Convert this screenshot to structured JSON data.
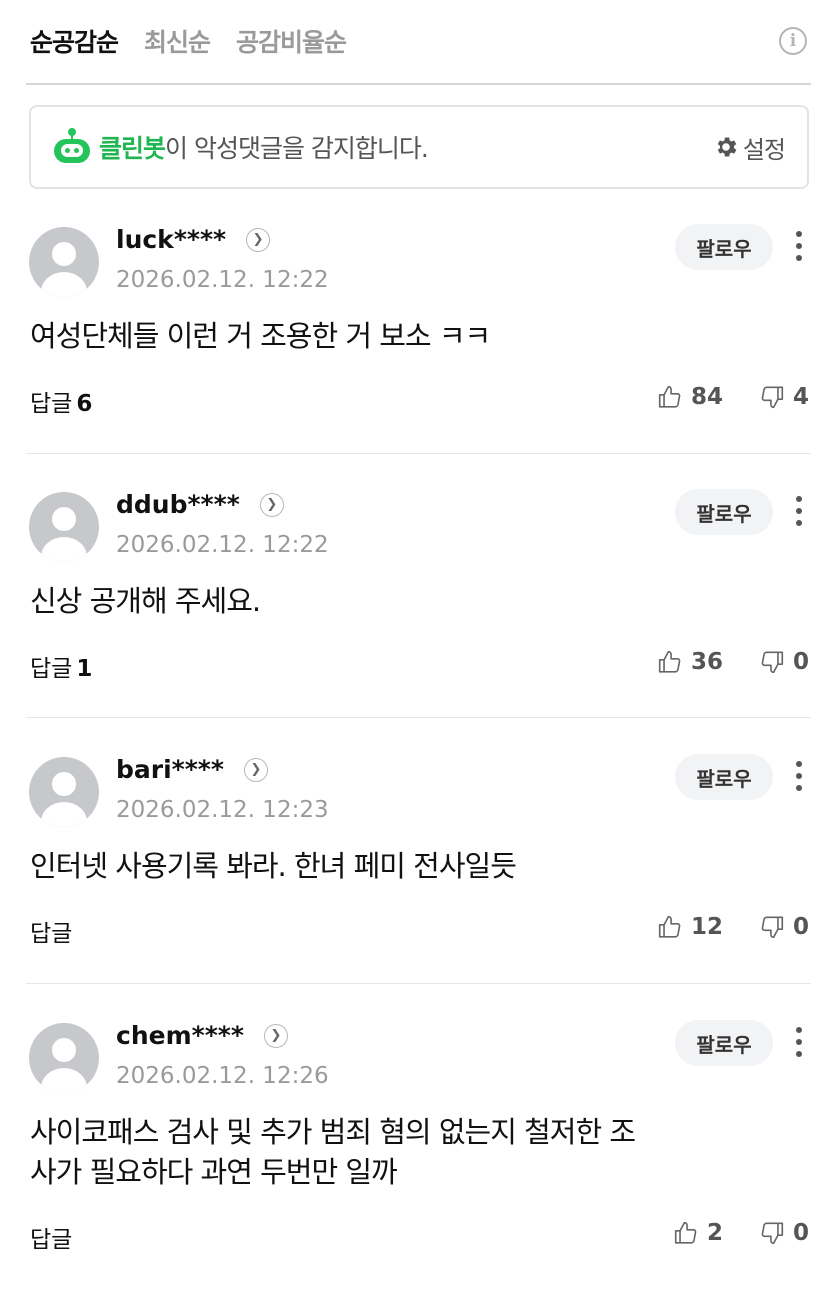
{
  "sort_tabs": [
    "순공감순",
    "최신순",
    "공감비율순"
  ],
  "info_icon_glyph": "i",
  "cleanbot": {
    "brand": "클린봇",
    "message": "이 악성댓글을 감지합니다.",
    "settings_label": "설정"
  },
  "follow_label": "팔로우",
  "reply_label": "답글",
  "comments": [
    {
      "user": "luck****",
      "date": "2026.02.12. 12:22",
      "text": "여성단체들 이런 거 조용한 거 보소 ㅋㅋ",
      "replies": "6",
      "likes": "84",
      "dislikes": "4"
    },
    {
      "user": "ddub****",
      "date": "2026.02.12. 12:22",
      "text": "신상 공개해 주세요.",
      "replies": "1",
      "likes": "36",
      "dislikes": "0"
    },
    {
      "user": "bari****",
      "date": "2026.02.12. 12:23",
      "text": "인터넷 사용기록 봐라. 한녀 페미 전사일듯",
      "replies": "",
      "likes": "12",
      "dislikes": "0"
    },
    {
      "user": "chem****",
      "date": "2026.02.12. 12:26",
      "text_lines": [
        "사이코패스 검사 및 추가 범죄 혐의 없는지 철저한 조",
        "사가 필요하다 과연 두번만 일까"
      ],
      "replies": "",
      "likes": "2",
      "dislikes": "0"
    }
  ]
}
